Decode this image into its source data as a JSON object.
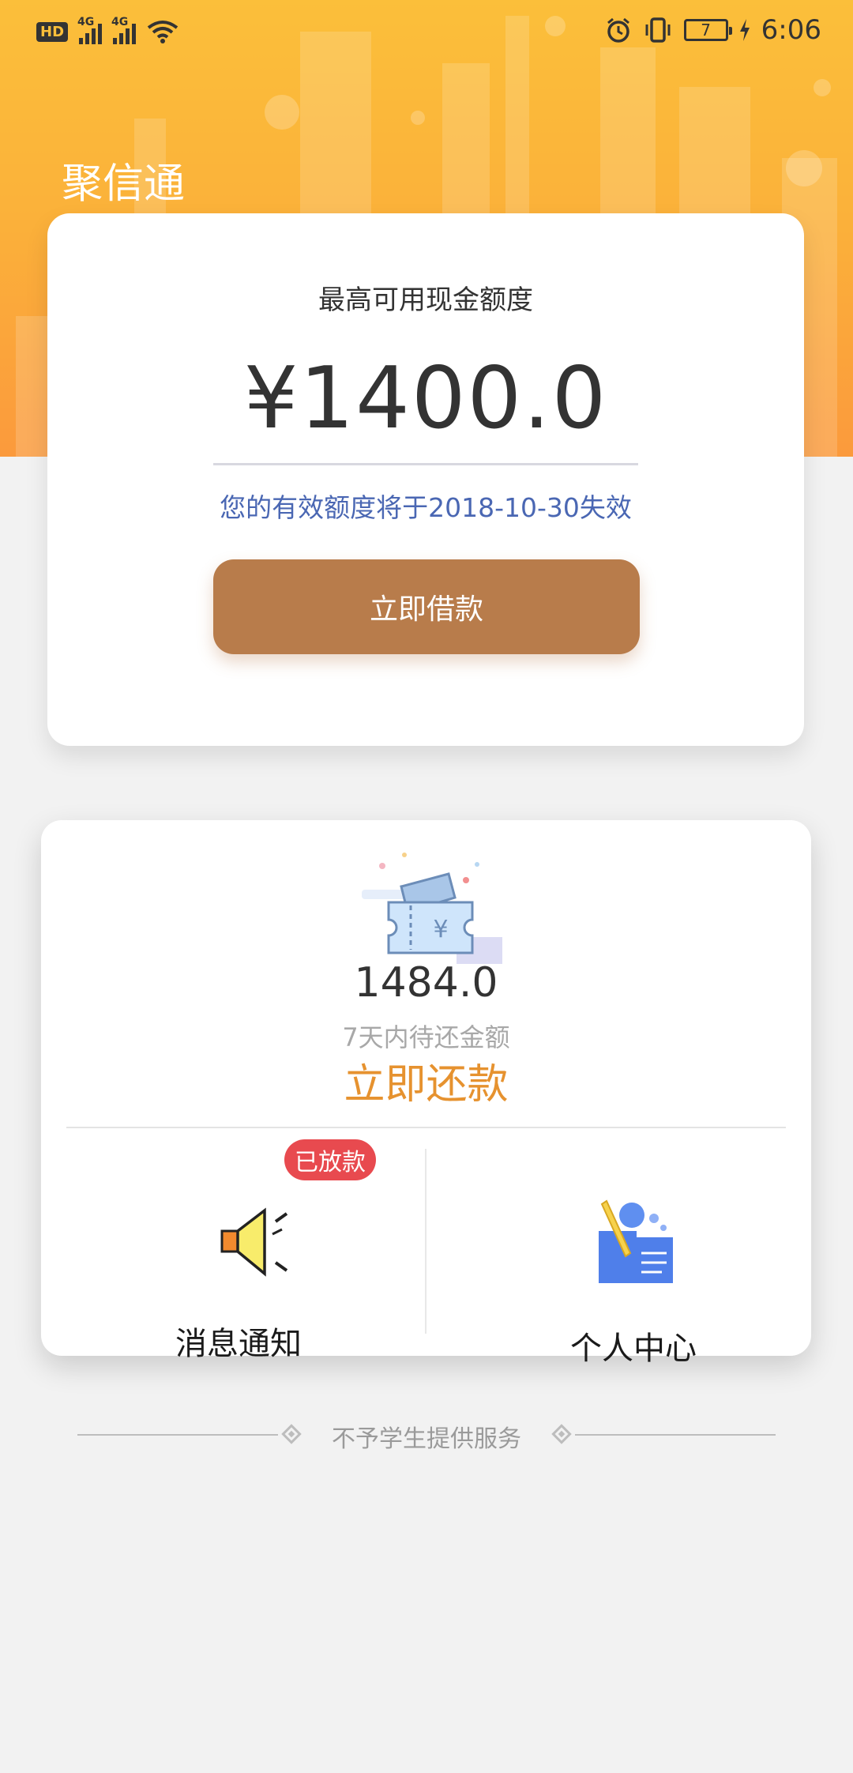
{
  "status_bar": {
    "hd": "HD",
    "net1": "4G",
    "net2": "4G",
    "battery_level": "7",
    "time": "6:06"
  },
  "app": {
    "title": "聚信通"
  },
  "credit_card": {
    "label": "最高可用现金额度",
    "amount": "¥1400.0",
    "expiry_notice": "您的有效额度将于2018-10-30失效",
    "borrow_button": "立即借款"
  },
  "repay_card": {
    "amount": "1484.0",
    "subtitle": "7天内待还金额",
    "repay_button": "立即还款",
    "ticket_icon": "ticket-yuan-icon",
    "cells": [
      {
        "label": "消息通知",
        "icon": "speaker-icon",
        "badge": "已放款"
      },
      {
        "label": "个人中心",
        "icon": "profile-icon"
      }
    ]
  },
  "footer": {
    "text": "不予学生提供服务"
  },
  "colors": {
    "hero_top": "#fbbf3a",
    "hero_bottom": "#fb9a3c",
    "borrow_button": "#b87c4b",
    "repay_text": "#e6922f",
    "expiry_text": "#4a67b3",
    "badge": "#e84a4f"
  }
}
